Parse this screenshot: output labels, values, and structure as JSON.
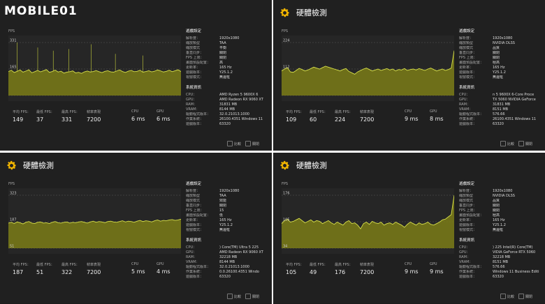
{
  "header": {
    "logo_text": "MOBILE01",
    "logo_badge": "MOBILE"
  },
  "panels": [
    {
      "title": "",
      "fps_label": "FPS",
      "y_ticks": [
        "331",
        "165",
        ""
      ],
      "stats": [
        {
          "label": "平均 FPS：",
          "value": "149"
        },
        {
          "label": "最低 FPS：",
          "value": "37"
        },
        {
          "label": "最高 FPS：",
          "value": "331"
        },
        {
          "label": "幀率表現",
          "value": "7200"
        },
        {
          "label": "CPU",
          "value": "6 ms"
        },
        {
          "label": "GPU",
          "value": "6 ms"
        }
      ],
      "game_settings_title": "遊戲設定",
      "game_settings": [
        {
          "k": "解析度：",
          "v": "1920x1080"
        },
        {
          "k": "縮放類型",
          "v": "TAA"
        },
        {
          "k": "縮放模式",
          "v": "平衡"
        },
        {
          "k": "垂直同步：",
          "v": "關閉"
        },
        {
          "k": "FPS 上限：",
          "v": "關閉"
        },
        {
          "k": "畫面預設配置：",
          "v": "高"
        },
        {
          "k": "更新率：",
          "v": "165 Hz"
        },
        {
          "k": "遊戲版本：",
          "v": "Y25.1.2"
        },
        {
          "k": "視窗模式：",
          "v": "無邊框"
        }
      ],
      "system_title": "系統資訊",
      "system": [
        {
          "k": "CPU：",
          "v": "AMD Ryzen 5 9600X 6"
        },
        {
          "k": "GPU：",
          "v": "AMD Radeon RX 9060 XT"
        },
        {
          "k": "RAM：",
          "v": "31831 MB"
        },
        {
          "k": "VRAM：",
          "v": "8144 MB"
        },
        {
          "k": "驅動程式版本：",
          "v": "32.0.21013.1000"
        },
        {
          "k": "作業系統：",
          "v": "26100.4351 Windows 11"
        },
        {
          "k": "遊戲版本：",
          "v": "63320"
        }
      ],
      "footer": {
        "compare": "比較",
        "close": "關閉"
      },
      "chart_data": {
        "type": "line",
        "title": "",
        "ylabel": "FPS",
        "y_ticks": [
          331,
          165
        ],
        "ylim": [
          0,
          331
        ],
        "series": [
          {
            "values": [
              150,
              158,
              144,
              151,
              160,
              146,
              153,
              161,
              142,
              149,
              157,
              148,
              155,
              162,
              145,
              150,
              159,
              147,
              152,
              140,
              146,
              149,
              154,
              141,
              145,
              138,
              148,
              153,
              147,
              150,
              156,
              149,
              143,
              151,
              155,
              148,
              146,
              153,
              160,
              150,
              144,
              152,
              157,
              149,
              151,
              158,
              146,
              150,
              155,
              148,
              152,
              160,
              154,
              147,
              151,
              158,
              149,
              155,
              161,
              150
            ]
          }
        ],
        "spikes": [
          {
            "x": 0.05,
            "y": 331
          },
          {
            "x": 0.17,
            "y": 300
          },
          {
            "x": 0.26,
            "y": 280
          },
          {
            "x": 0.35,
            "y": 290
          },
          {
            "x": 0.48,
            "y": 320
          },
          {
            "x": 0.62,
            "y": 260
          },
          {
            "x": 0.78,
            "y": 250
          }
        ],
        "min_value": 37
      }
    },
    {
      "title": "硬體檢測",
      "fps_label": "FPS",
      "y_ticks": [
        "224",
        "112",
        ""
      ],
      "stats": [
        {
          "label": "平均 FPS：",
          "value": "109"
        },
        {
          "label": "最低 FPS：",
          "value": "60"
        },
        {
          "label": "最高 FPS：",
          "value": "224"
        },
        {
          "label": "幀率表現",
          "value": "7200"
        },
        {
          "label": "CPU",
          "value": "9 ms"
        },
        {
          "label": "GPU",
          "value": "8 ms"
        }
      ],
      "game_settings_title": "遊戲設定",
      "game_settings": [
        {
          "k": "解析度：",
          "v": "1920x1080"
        },
        {
          "k": "縮放類型",
          "v": "NVIDIA DLSS"
        },
        {
          "k": "縮放模式",
          "v": "品質"
        },
        {
          "k": "垂直同步：",
          "v": "關閉"
        },
        {
          "k": "FPS 上限：",
          "v": "關閉"
        },
        {
          "k": "畫面預設配置：",
          "v": "極高"
        },
        {
          "k": "更新率：",
          "v": "165 Hz"
        },
        {
          "k": "遊戲版本：",
          "v": "Y25.1.2"
        },
        {
          "k": "視窗模式：",
          "v": "無邊框"
        }
      ],
      "system_title": "系統資訊",
      "system": [
        {
          "k": "CPU：",
          "v": "n 5 9600X 6-Core Proce"
        },
        {
          "k": "GPU：",
          "v": "TX 5060 NVIDIA GeForce"
        },
        {
          "k": "RAM：",
          "v": "31831 MB"
        },
        {
          "k": "VRAM：",
          "v": "8151 MB"
        },
        {
          "k": "驅動程式版本：",
          "v": "576.66"
        },
        {
          "k": "作業系統：",
          "v": "26100.4351 Windows 11"
        },
        {
          "k": "遊戲版本：",
          "v": "63320"
        }
      ],
      "footer": {
        "compare": "比較",
        "close": "關閉"
      },
      "chart_data": {
        "type": "line",
        "title": "",
        "ylabel": "FPS",
        "y_ticks": [
          224,
          112
        ],
        "ylim": [
          0,
          224
        ],
        "series": [
          {
            "values": [
              104,
              112,
              118,
              100,
              98,
              106,
              115,
              110,
              104,
              108,
              114,
              120,
              116,
              112,
              118,
              124,
              120,
              116,
              112,
              108,
              104,
              110,
              114,
              102,
              96,
              90,
              100,
              106,
              112,
              116,
              110,
              104,
              108,
              112,
              106,
              110,
              114,
              108,
              112,
              104,
              110,
              108,
              114,
              106,
              110,
              112,
              108,
              114,
              110,
              106,
              112,
              116,
              110,
              104,
              108,
              112,
              106,
              110,
              116,
              190
            ]
          }
        ],
        "spikes": [],
        "min_value": 60
      }
    },
    {
      "title": "硬體檢測",
      "fps_label": "FPS",
      "y_ticks": [
        "323",
        "187",
        "51"
      ],
      "stats": [
        {
          "label": "平均 FPS：",
          "value": "187"
        },
        {
          "label": "最低 FPS：",
          "value": "51"
        },
        {
          "label": "最高 FPS：",
          "value": "322"
        },
        {
          "label": "幀率表現",
          "value": "7200"
        },
        {
          "label": "CPU",
          "value": "5 ms"
        },
        {
          "label": "GPU",
          "value": "4 ms"
        }
      ],
      "game_settings_title": "遊戲設定",
      "game_settings": [
        {
          "k": "解析度：",
          "v": "1920x1080"
        },
        {
          "k": "縮放類型",
          "v": "TAA"
        },
        {
          "k": "縮放模式",
          "v": "效能"
        },
        {
          "k": "垂直同步：",
          "v": "關閉"
        },
        {
          "k": "FPS 上限：",
          "v": "15"
        },
        {
          "k": "畫面預設配置：",
          "v": "低"
        },
        {
          "k": "更新率：",
          "v": "165 Hz"
        },
        {
          "k": "遊戲版本：",
          "v": "Y25.1.2"
        },
        {
          "k": "視窗模式：",
          "v": "無邊框"
        }
      ],
      "system_title": "系統資訊",
      "system": [
        {
          "k": "CPU：",
          "v": ") Core(TM) Ultra 5 225"
        },
        {
          "k": "GPU：",
          "v": "AMD Radeon RX 9060 XT"
        },
        {
          "k": "RAM：",
          "v": "32218 MB"
        },
        {
          "k": "VRAM：",
          "v": "8144 MB"
        },
        {
          "k": "驅動程式版本：",
          "v": "32.0.21013.1000"
        },
        {
          "k": "作業系統：",
          "v": "0.0.26100.4351 Windo"
        },
        {
          "k": "遊戲版本：",
          "v": "63320"
        }
      ],
      "footer": {
        "compare": "比較",
        "close": "關閉"
      },
      "chart_data": {
        "type": "line",
        "title": "",
        "ylabel": "FPS",
        "y_ticks": [
          323,
          187,
          51
        ],
        "ylim": [
          51,
          323
        ],
        "series": [
          {
            "values": [
              180,
              184,
              178,
              186,
              182,
              176,
              184,
              188,
              180,
              178,
              184,
              186,
              180,
              182,
              178,
              184,
              188,
              182,
              180,
              184,
              186,
              180,
              184,
              182,
              186,
              188,
              184,
              180,
              186,
              190,
              184,
              188,
              186,
              182,
              188,
              190,
              186,
              184,
              188,
              192,
              186,
              190,
              188,
              184,
              190,
              194,
              188,
              192,
              190,
              186,
              192,
              196,
              190,
              194,
              192,
              196,
              198,
              194,
              196,
              200
            ]
          }
        ],
        "spikes": [],
        "min_value": 51
      }
    },
    {
      "title": "硬體檢測",
      "fps_label": "FPS",
      "y_ticks": [
        "176",
        "105",
        "34"
      ],
      "stats": [
        {
          "label": "平均 FPS：",
          "value": "105"
        },
        {
          "label": "最低 FPS：",
          "value": "49"
        },
        {
          "label": "最高 FPS：",
          "value": "176"
        },
        {
          "label": "幀率表現",
          "value": "7200"
        },
        {
          "label": "CPU",
          "value": "9 ms"
        },
        {
          "label": "GPU",
          "value": "9 ms"
        }
      ],
      "game_settings_title": "遊戲設定",
      "game_settings": [
        {
          "k": "解析度：",
          "v": "1920x1080"
        },
        {
          "k": "縮放類型",
          "v": "NVIDIA DLSS"
        },
        {
          "k": "縮放模式",
          "v": "品質"
        },
        {
          "k": "垂直同步：",
          "v": "關閉"
        },
        {
          "k": "FPS 上限：",
          "v": "關閉"
        },
        {
          "k": "畫面預設配置：",
          "v": "極高"
        },
        {
          "k": "更新率：",
          "v": "165 Hz"
        },
        {
          "k": "遊戲版本：",
          "v": "Y25.1.2"
        },
        {
          "k": "視窗模式：",
          "v": "無邊框"
        }
      ],
      "system_title": "系統資訊",
      "system": [
        {
          "k": "CPU：",
          "v": ") 225 Intel(R) Core(TM)"
        },
        {
          "k": "GPU：",
          "v": "VIDIA GeForce RTX 5060"
        },
        {
          "k": "RAM：",
          "v": "32218 MB"
        },
        {
          "k": "VRAM：",
          "v": "8151 MB"
        },
        {
          "k": "驅動程式版本：",
          "v": "576.66"
        },
        {
          "k": "作業系統：",
          "v": "Windows 11 Business Editi"
        },
        {
          "k": "遊戲版本：",
          "v": "63320"
        }
      ],
      "footer": {
        "compare": "比較",
        "close": "關閉"
      },
      "chart_data": {
        "type": "line",
        "title": "",
        "ylabel": "FPS",
        "y_ticks": [
          176,
          105,
          34
        ],
        "ylim": [
          34,
          176
        ],
        "series": [
          {
            "values": [
              100,
              108,
              112,
              104,
              106,
              110,
              114,
              108,
              102,
              106,
              110,
              104,
              108,
              106,
              100,
              104,
              108,
              102,
              98,
              104,
              100,
              96,
              104,
              108,
              100,
              102,
              96,
              86,
              100,
              104,
              98,
              106,
              102,
              100,
              104,
              96,
              100,
              102,
              98,
              104,
              100,
              96,
              90,
              98,
              104,
              100,
              96,
              102,
              98,
              100,
              104,
              98,
              96,
              100,
              104,
              110,
              112,
              118,
              124,
              176
            ]
          }
        ],
        "spikes": [],
        "min_value": 49
      }
    }
  ]
}
